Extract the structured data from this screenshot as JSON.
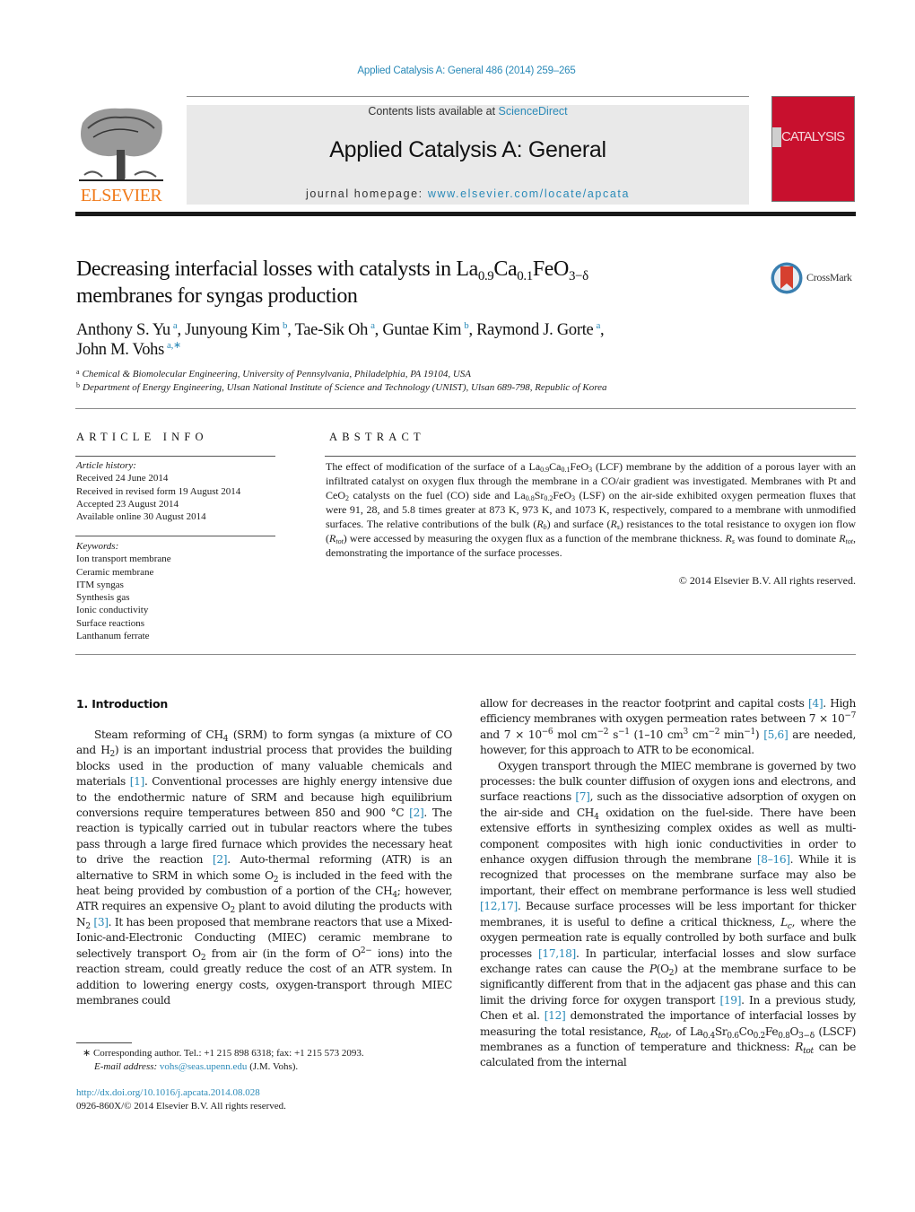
{
  "header": {
    "citation": "Applied Catalysis A: General 486 (2014) 259–265",
    "contents_prefix": "Contents lists available at ",
    "contents_link": "ScienceDirect",
    "journal_title": "Applied Catalysis A: General",
    "homepage_prefix": "journal homepage: ",
    "homepage_link": "www.elsevier.com/locate/apcata",
    "publisher_logo_text": "ELSEVIER",
    "cover_text": "CATALYSIS",
    "crossmark_label": "CrossMark",
    "colors": {
      "link": "#2a8ab8",
      "publisher_orange": "#f07a1a",
      "cover_red": "#c8102e",
      "box_gray": "#e9e9e9"
    }
  },
  "article": {
    "title_part1": "Decreasing interfacial losses with catalysts in La",
    "title_sub1": "0.9",
    "title_part2": "Ca",
    "title_sub2": "0.1",
    "title_part3": "FeO",
    "title_sub3": "3−δ",
    "title_line2": "membranes for syngas production",
    "authors": [
      {
        "name": "Anthony S. Yu",
        "aff": "a",
        "sep": ", "
      },
      {
        "name": "Junyoung Kim",
        "aff": "b",
        "sep": ", "
      },
      {
        "name": "Tae-Sik Oh",
        "aff": "a",
        "sep": ", "
      },
      {
        "name": "Guntae Kim",
        "aff": "b",
        "sep": ", "
      },
      {
        "name": "Raymond J. Gorte",
        "aff": "a",
        "sep": ","
      },
      {
        "name": "John M. Vohs",
        "aff": "a,∗",
        "sep": ""
      }
    ],
    "affiliations": [
      {
        "mark": "a",
        "text": "Chemical & Biomolecular Engineering, University of Pennsylvania, Philadelphia, PA 19104, USA"
      },
      {
        "mark": "b",
        "text": "Department of Energy Engineering, Ulsan National Institute of Science and Technology (UNIST), Ulsan 689-798, Republic of Korea"
      }
    ]
  },
  "article_info": {
    "heading": "ARTICLE INFO",
    "history_label": "Article history:",
    "history": [
      "Received 24 June 2014",
      "Received in revised form 19 August 2014",
      "Accepted 23 August 2014",
      "Available online 30 August 2014"
    ],
    "keywords_label": "Keywords:",
    "keywords": [
      "Ion transport membrane",
      "Ceramic membrane",
      "ITM syngas",
      "Synthesis gas",
      "Ionic conductivity",
      "Surface reactions",
      "Lanthanum ferrate"
    ]
  },
  "abstract": {
    "heading": "ABSTRACT",
    "t1": "The effect of modification of the surface of a La",
    "s1": "0.9",
    "t2": "Ca",
    "s2": "0.1",
    "t3": "FeO",
    "s3": "3",
    "t4": " (LCF) membrane by the addition of a porous layer with an infiltrated catalyst on oxygen flux through the membrane in a CO/air gradient was investigated. Membranes with Pt and CeO",
    "s4": "2",
    "t5": " catalysts on the fuel (CO) side and La",
    "s5": "0.8",
    "t6": "Sr",
    "s6": "0.2",
    "t7": "FeO",
    "s7": "3",
    "t8": " (LSF) on the air-side exhibited oxygen permeation fluxes that were 91, 28, and 5.8 times greater at 873 K, 973 K, and 1073 K, respectively, compared to a membrane with unmodified surfaces. The relative contributions of the bulk (",
    "rb": "R",
    "rb_sub": "b",
    "t9": ") and surface (",
    "rs": "R",
    "rs_sub": "s",
    "t10": ") resistances to the total resistance to oxygen ion flow (",
    "rt": "R",
    "rt_sub": "tot",
    "t11": ") were accessed by measuring the oxygen flux as a function of the membrane thickness. ",
    "rs2": "R",
    "rs2_sub": "s",
    "t12": " was found to dominate ",
    "rt2": "R",
    "rt2_sub": "tot",
    "t13": ", demonstrating the importance of the surface processes.",
    "copyright": "© 2014 Elsevier B.V. All rights reserved."
  },
  "body": {
    "section_heading": "1.  Introduction",
    "left": {
      "a1": "Steam reforming of CH",
      "a1s": "4",
      "a2": " (SRM) to form syngas (a mixture of CO and H",
      "a2s": "2",
      "a3": ") is an important industrial process that provides the building blocks used in the production of many valuable chemicals and materials ",
      "r1": "[1]",
      "a4": ". Conventional processes are highly energy intensive due to the endothermic nature of SRM and because high equilibrium conversions require temperatures between 850 and 900 °C ",
      "r2": "[2]",
      "a5": ". The reaction is typically carried out in tubular reactors where the tubes pass through a large fired furnace which provides the necessary heat to drive the reaction ",
      "r3": "[2]",
      "a6": ". Auto-thermal reforming (ATR) is an alternative to SRM in which some O",
      "a6s": "2",
      "a7": " is included in the feed with the heat being provided by combustion of a portion of the CH",
      "a7s": "4",
      "a8": "; however, ATR requires an expensive O",
      "a8s": "2",
      "a9": " plant to avoid diluting the products with N",
      "a9s": "2",
      "a10": " ",
      "r4": "[3]",
      "a11": ". It has been proposed that membrane reactors that use a Mixed-Ionic-and-Electronic Conducting (MIEC) ceramic membrane to selectively transport O",
      "a11s": "2",
      "a12": " from air (in the form of O",
      "a12sup": "2−",
      "a13": " ions) into the reaction stream, could greatly reduce the cost of an ATR system. In addition to lowering energy costs, oxygen-transport through MIEC membranes could"
    },
    "right": {
      "b1": "allow for decreases in the reactor footprint and capital costs ",
      "r1": "[4]",
      "b2": ". High efficiency membranes with oxygen permeation rates between 7 × 10",
      "b2sup": "−7",
      "b3": " and 7 × 10",
      "b3sup": "−6",
      "b4": " mol cm",
      "b4sup": "−2",
      "b5": " s",
      "b5sup": "−1",
      "b6": " (1–10 cm",
      "b6sup": "3",
      "b7": " cm",
      "b7sup": "−2",
      "b8": " min",
      "b8sup": "−1",
      "b9": ") ",
      "r2": "[5,6]",
      "b10": " are needed, however, for this approach to ATR to be economical.",
      "c1": "Oxygen transport through the MIEC membrane is governed by two processes: the bulk counter diffusion of oxygen ions and electrons, and surface reactions ",
      "r3": "[7]",
      "c2": ", such as the dissociative adsorption of oxygen on the air-side and CH",
      "c2s": "4",
      "c3": " oxidation on the fuel-side. There have been extensive efforts in synthesizing complex oxides as well as multi-component composites with high ionic conductivities in order to enhance oxygen diffusion through the membrane ",
      "r4": "[8–16]",
      "c4": ". While it is recognized that processes on the membrane surface may also be important, their effect on membrane performance is less well studied ",
      "r5": "[12,17]",
      "c5": ". Because surface processes will be less important for thicker membranes, it is useful to define a critical thickness, ",
      "lc": "L",
      "lc_sub": "c",
      "c6": ", where the oxygen permeation rate is equally controlled by both surface and bulk processes ",
      "r6": "[17,18]",
      "c7": ". In particular, interfacial losses and slow surface exchange rates can cause the ",
      "p": "P",
      "c8": "(O",
      "c8s": "2",
      "c9": ") at the membrane surface to be significantly different from that in the adjacent gas phase and this can limit the driving force for oxygen transport ",
      "r7": "[19]",
      "c10": ". In a previous study, Chen et al. ",
      "r8": "[12]",
      "c11": " demonstrated the importance of interfacial losses by measuring the total resistance, ",
      "rt": "R",
      "rt_sub": "tot",
      "c12": ", of La",
      "s1": "0.4",
      "c13": "Sr",
      "s2": "0.6",
      "c14": "Co",
      "s3": "0.2",
      "c15": "Fe",
      "s4": "0.8",
      "c16": "O",
      "s5": "3−δ",
      "c17": " (LSCF) membranes as a function of temperature and thickness: ",
      "rt2": "R",
      "rt2_sub": "tot",
      "c18": " can be calculated from the internal"
    }
  },
  "footnotes": {
    "star": "∗",
    "corresponding": " Corresponding author. Tel.: +1 215 898 6318; fax: +1 215 573 2093.",
    "email_label": "E-mail address:",
    "email": "vohs@seas.upenn.edu",
    "email_suffix": " (J.M. Vohs).",
    "doi": "http://dx.doi.org/10.1016/j.apcata.2014.08.028",
    "issn_copyright": "0926-860X/© 2014 Elsevier B.V. All rights reserved."
  }
}
